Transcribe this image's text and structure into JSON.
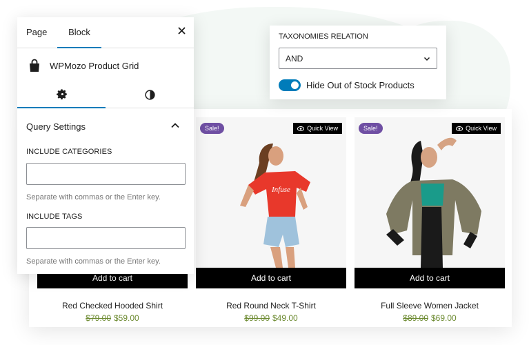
{
  "panel": {
    "tabs": {
      "page": "Page",
      "block": "Block"
    },
    "close_icon": "close-icon",
    "block_name": "WPMozo Product Grid",
    "block_icon": "shopping-bag-icon",
    "subtabs": {
      "settings_icon": "gear-icon",
      "styles_icon": "half-circle-contrast-icon"
    },
    "query_settings": {
      "title": "Query Settings",
      "include_categories": {
        "label": "INCLUDE CATEGORIES",
        "value": "",
        "help": "Separate with commas or the Enter key."
      },
      "include_tags": {
        "label": "INCLUDE TAGS",
        "value": "",
        "help": "Separate with commas or the Enter key."
      }
    }
  },
  "taxonomies": {
    "label": "TAXONOMIES RELATION",
    "selected": "AND",
    "toggle": {
      "label": "Hide Out of Stock Products",
      "on": true
    }
  },
  "products": [
    {
      "name": "Red Checked Hooded Shirt",
      "old_price": "$79.00",
      "price": "$59.00",
      "cart_label": "Add to cart",
      "sale": "",
      "quick_view": ""
    },
    {
      "name": "Red Round Neck T-Shirt",
      "old_price": "$99.00",
      "price": "$49.00",
      "cart_label": "Add to cart",
      "sale": "Sale!",
      "quick_view": "Quick View"
    },
    {
      "name": "Full Sleeve Women Jacket",
      "old_price": "$89.00",
      "price": "$69.00",
      "cart_label": "Add to cart",
      "sale": "Sale!",
      "quick_view": "Quick View"
    }
  ],
  "colors": {
    "accent": "#007cba",
    "sale_badge": "#6f4fa3",
    "price": "#6c8a30",
    "button": "#000000"
  }
}
